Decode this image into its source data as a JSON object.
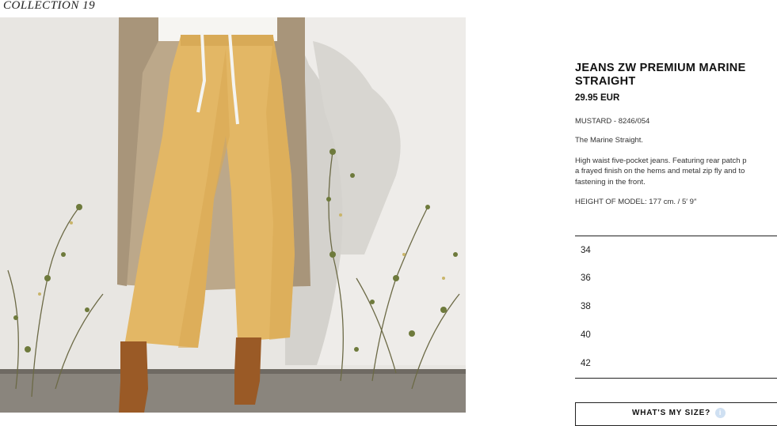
{
  "collection": {
    "label": "COLLECTION 19"
  },
  "product": {
    "title": "JEANS ZW PREMIUM MARINE STRAIGHT",
    "price": "29.95 EUR",
    "color_ref": "MUSTARD - 8246/054",
    "short_desc": "The Marine Straight.",
    "description_lines": [
      "High waist five-pocket jeans. Featuring rear patch p",
      "a frayed finish on the hems and metal zip fly and to",
      "fastening in the front."
    ],
    "model_height": "HEIGHT OF MODEL: 177 cm. / 5′ 9″"
  },
  "sizes": [
    "34",
    "36",
    "38",
    "40",
    "42"
  ],
  "size_guide": {
    "label": "WHAT'S MY SIZE?"
  },
  "colors": {
    "pants": "#e3b765",
    "coat": "#bca88a",
    "wall": "#e8e6e2",
    "boots": "#9a5a26"
  }
}
